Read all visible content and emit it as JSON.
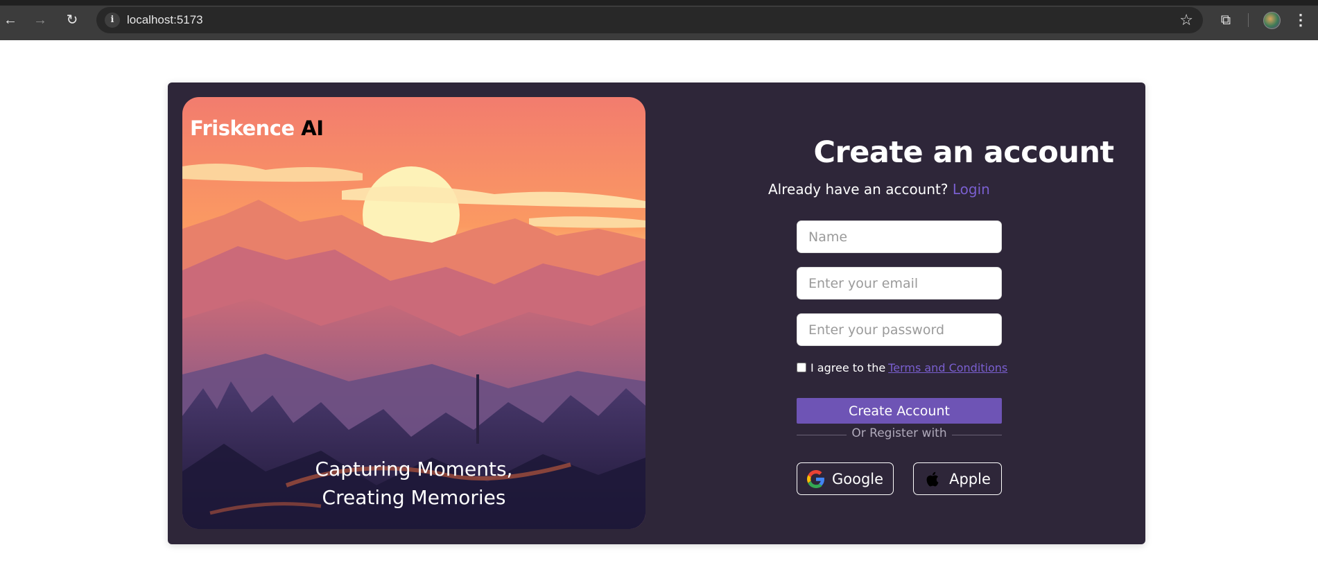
{
  "browser": {
    "url": "localhost:5173",
    "back_icon": "←",
    "forward_icon": "→",
    "reload_icon": "↻",
    "info_icon": "i",
    "star_icon": "☆",
    "extensions_icon": "⧉",
    "menu_icon": "⋮"
  },
  "hero": {
    "brand_primary": "Friskence",
    "brand_secondary": "AI",
    "caption_line1": "Capturing Moments,",
    "caption_line2": "Creating Memories"
  },
  "form": {
    "title": "Create an account",
    "login_prompt": "Already have an account?",
    "login_link": "Login",
    "name_placeholder": "Name",
    "email_placeholder": "Enter your email",
    "password_placeholder": "Enter your password",
    "terms_prefix": "I agree to the",
    "terms_link": "Terms and Conditions",
    "submit_label": "Create Account",
    "divider_text": "Or Register with",
    "google_label": "Google",
    "apple_label": "Apple"
  },
  "colors": {
    "card_bg": "#2e2639",
    "accent": "#6e54b5",
    "link": "#7a5fd0"
  }
}
